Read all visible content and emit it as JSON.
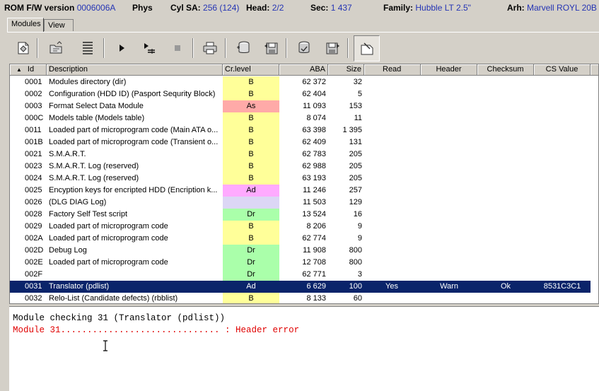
{
  "infobar": {
    "rom_label": "ROM F/W version",
    "rom_value": "0006006A",
    "phys_label": "Phys",
    "cyl_label": "Cyl SA:",
    "cyl_value": "256 (124)",
    "head_label": "Head:",
    "head_value": "2/2",
    "sec_label": "Sec:",
    "sec_value": "1 437",
    "family_label": "Family:",
    "family_value": "Hubble LT 2.5\"",
    "arh_label": "Arh:",
    "arh_value": "Marvell ROYL 20B"
  },
  "tabs": [
    {
      "label": "Modules"
    },
    {
      "label": "View"
    }
  ],
  "toolbar": {
    "icons": [
      "module-edit-icon",
      "module-open-icon",
      "list-view-icon",
      "play-icon",
      "step-icon",
      "stop-icon",
      "print-icon",
      "disk-read-icon",
      "disk-save-icon",
      "disk-check-icon",
      "disk-write-icon",
      "note-icon"
    ]
  },
  "columns": [
    {
      "label": "Id",
      "sort": "▲"
    },
    {
      "label": "Description"
    },
    {
      "label": "Cr.level"
    },
    {
      "label": "ABA"
    },
    {
      "label": "Size"
    },
    {
      "label": "Read"
    },
    {
      "label": "Header"
    },
    {
      "label": "Checksum"
    },
    {
      "label": "CS Value"
    }
  ],
  "level_colors": {
    "B": "#ffff99",
    "As": "#ffaaa8",
    "Ad": "#ffaaff",
    "Dr": "#aaffaa",
    "": "#dcd6f5"
  },
  "rows": [
    {
      "id": "0001",
      "desc": "Modules directory (dir)",
      "level": "B",
      "aba": "62 372",
      "size": "32",
      "read": "",
      "header": "",
      "checksum": "",
      "cs": ""
    },
    {
      "id": "0002",
      "desc": "Configuration (HDD ID) (Pasport Sequrity Block)",
      "level": "B",
      "aba": "62 404",
      "size": "5",
      "read": "",
      "header": "",
      "checksum": "",
      "cs": ""
    },
    {
      "id": "0003",
      "desc": "Format Select Data Module",
      "level": "As",
      "aba": "11 093",
      "size": "153",
      "read": "",
      "header": "",
      "checksum": "",
      "cs": ""
    },
    {
      "id": "000C",
      "desc": "Models table (Models table)",
      "level": "B",
      "aba": "8 074",
      "size": "11",
      "read": "",
      "header": "",
      "checksum": "",
      "cs": ""
    },
    {
      "id": "0011",
      "desc": "Loaded part of microprogram code (Main ATA o...",
      "level": "B",
      "aba": "63 398",
      "size": "1 395",
      "read": "",
      "header": "",
      "checksum": "",
      "cs": ""
    },
    {
      "id": "001B",
      "desc": "Loaded part of microprogram code (Transient o...",
      "level": "B",
      "aba": "62 409",
      "size": "131",
      "read": "",
      "header": "",
      "checksum": "",
      "cs": ""
    },
    {
      "id": "0021",
      "desc": "S.M.A.R.T.",
      "level": "B",
      "aba": "62 783",
      "size": "205",
      "read": "",
      "header": "",
      "checksum": "",
      "cs": ""
    },
    {
      "id": "0023",
      "desc": "S.M.A.R.T. Log (reserved)",
      "level": "B",
      "aba": "62 988",
      "size": "205",
      "read": "",
      "header": "",
      "checksum": "",
      "cs": ""
    },
    {
      "id": "0024",
      "desc": "S.M.A.R.T. Log (reserved)",
      "level": "B",
      "aba": "63 193",
      "size": "205",
      "read": "",
      "header": "",
      "checksum": "",
      "cs": ""
    },
    {
      "id": "0025",
      "desc": "Encyption keys for encripted HDD (Encription k...",
      "level": "Ad",
      "aba": "11 246",
      "size": "257",
      "read": "",
      "header": "",
      "checksum": "",
      "cs": ""
    },
    {
      "id": "0026",
      "desc": " (DLG DIAG Log)",
      "level": "",
      "aba": "11 503",
      "size": "129",
      "read": "",
      "header": "",
      "checksum": "",
      "cs": ""
    },
    {
      "id": "0028",
      "desc": "Factory Self Test script",
      "level": "Dr",
      "aba": "13 524",
      "size": "16",
      "read": "",
      "header": "",
      "checksum": "",
      "cs": ""
    },
    {
      "id": "0029",
      "desc": "Loaded part of microprogram code",
      "level": "B",
      "aba": "8 206",
      "size": "9",
      "read": "",
      "header": "",
      "checksum": "",
      "cs": ""
    },
    {
      "id": "002A",
      "desc": "Loaded part of microprogram code",
      "level": "B",
      "aba": "62 774",
      "size": "9",
      "read": "",
      "header": "",
      "checksum": "",
      "cs": ""
    },
    {
      "id": "002D",
      "desc": "Debug Log",
      "level": "Dr",
      "aba": "11 908",
      "size": "800",
      "read": "",
      "header": "",
      "checksum": "",
      "cs": ""
    },
    {
      "id": "002E",
      "desc": "Loaded part of microprogram code",
      "level": "Dr",
      "aba": "12 708",
      "size": "800",
      "read": "",
      "header": "",
      "checksum": "",
      "cs": ""
    },
    {
      "id": "002F",
      "desc": "",
      "level": "Dr",
      "aba": "62 771",
      "size": "3",
      "read": "",
      "header": "",
      "checksum": "",
      "cs": ""
    },
    {
      "id": "0031",
      "desc": "Translator (pdlist)",
      "level": "Ad",
      "aba": "6 629",
      "size": "100",
      "read": "Yes",
      "header": "Warn",
      "checksum": "Ok",
      "cs": "8531C3C1",
      "selected": true
    },
    {
      "id": "0032",
      "desc": "Relo-List (Candidate defects) (rbblist)",
      "level": "B",
      "aba": "8 133",
      "size": "60",
      "read": "",
      "header": "",
      "checksum": "",
      "cs": ""
    }
  ],
  "log": {
    "line1": "Module checking 31 (Translator (pdlist))",
    "line2": "Module 31.............................. : Header error",
    "line1_color": "#000000",
    "line2_color": "#e00000"
  }
}
